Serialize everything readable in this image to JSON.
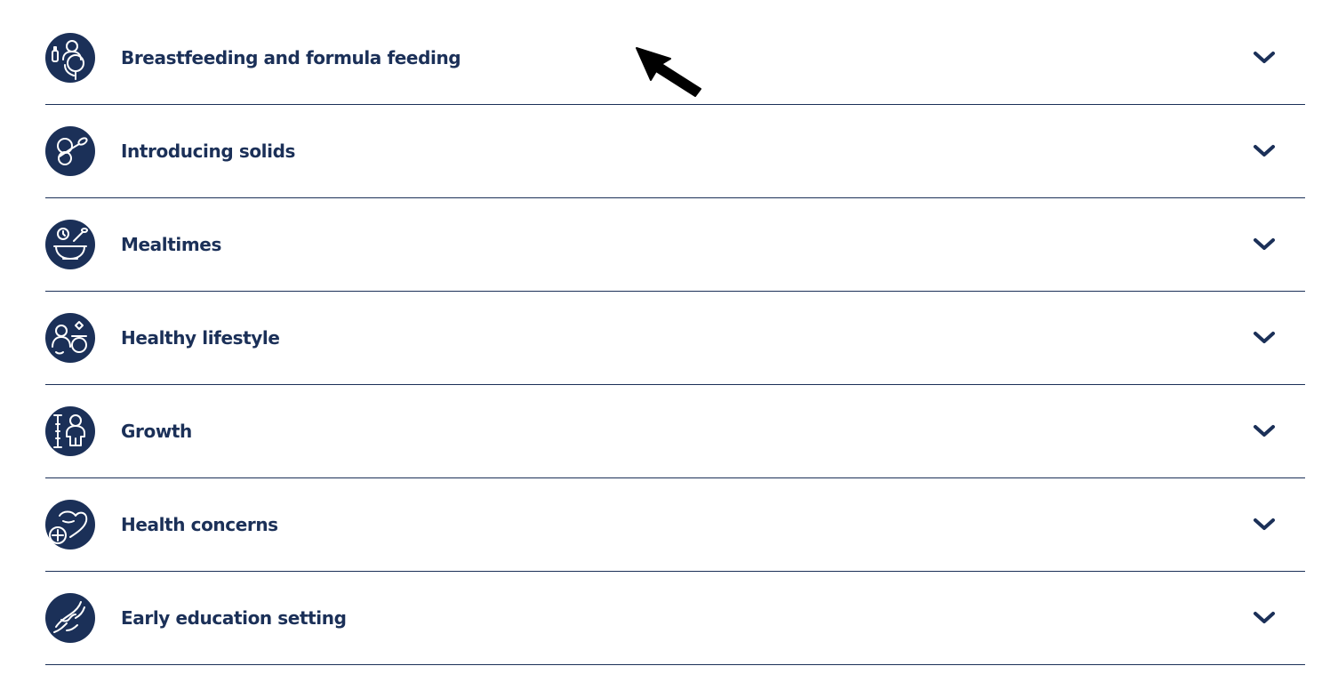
{
  "colors": {
    "brand_navy": "#1b3058",
    "background": "#ffffff"
  },
  "accordion": {
    "items": [
      {
        "label": "Breastfeeding and formula feeding",
        "icon": "parent-baby-bottle-icon"
      },
      {
        "label": "Introducing solids",
        "icon": "spoon-icon"
      },
      {
        "label": "Mealtimes",
        "icon": "bowl-clock-icon"
      },
      {
        "label": "Healthy lifestyle",
        "icon": "family-activity-icon"
      },
      {
        "label": "Growth",
        "icon": "height-measure-icon"
      },
      {
        "label": "Health concerns",
        "icon": "heart-plus-icon"
      },
      {
        "label": "Early education setting",
        "icon": "hands-icon"
      }
    ]
  },
  "cursor": {
    "icon": "mouse-pointer-icon"
  }
}
